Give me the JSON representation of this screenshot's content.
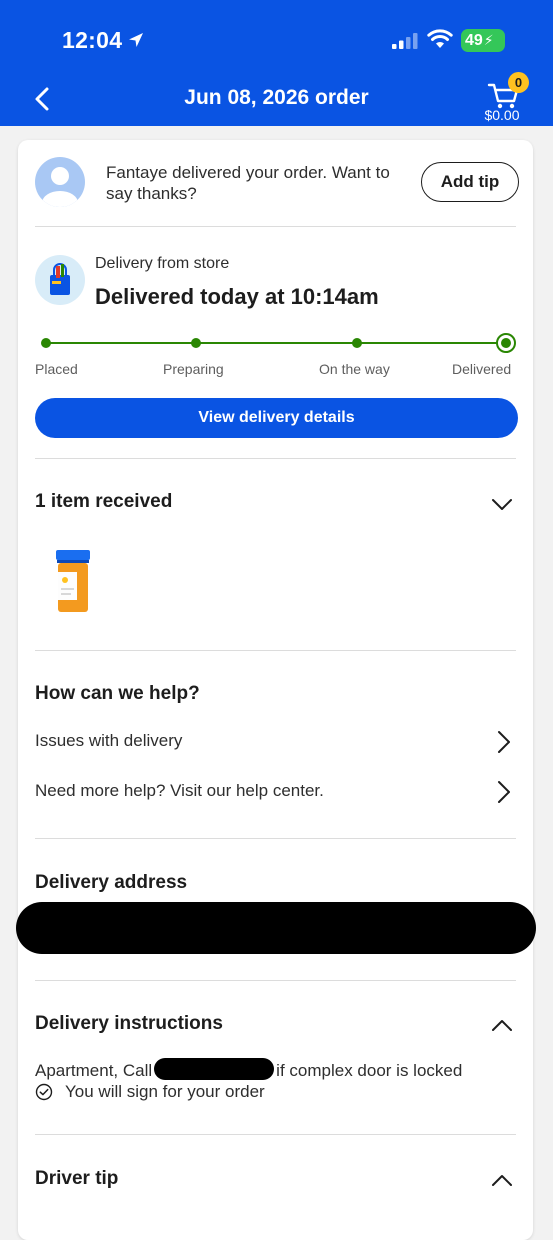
{
  "status_bar": {
    "time": "12:04",
    "battery": "49"
  },
  "header": {
    "title": "Jun 08, 2026 order",
    "cart_count": "0",
    "cart_total": "$0.00"
  },
  "thanks": {
    "message": "Fantaye delivered your order. Want to say thanks?",
    "button": "Add tip"
  },
  "delivery": {
    "from": "Delivery from store",
    "status": "Delivered today at 10:14am",
    "steps": [
      "Placed",
      "Preparing",
      "On the way",
      "Delivered"
    ],
    "button": "View delivery details"
  },
  "items": {
    "title": "1 item received"
  },
  "help": {
    "title": "How can we help?",
    "rows": [
      "Issues with delivery",
      "Need more help? Visit our help center."
    ]
  },
  "address": {
    "title": "Delivery address"
  },
  "instructions": {
    "title": "Delivery instructions",
    "text_before": "Apartment, Call",
    "text_after": "if complex door is locked",
    "sign": "You will sign for your order"
  },
  "tip": {
    "title": "Driver tip"
  },
  "colors": {
    "brand_blue": "#0a54e3",
    "success_green": "#2a8703",
    "badge_yellow": "#ffc220"
  }
}
